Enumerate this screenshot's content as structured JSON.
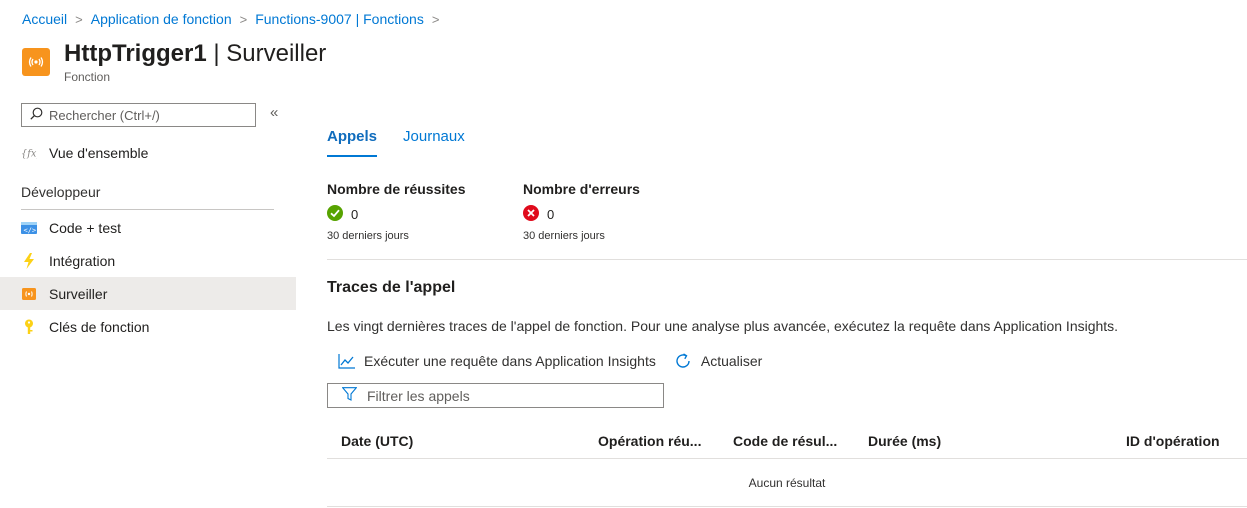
{
  "breadcrumb": {
    "items": [
      "Accueil",
      "Application de fonction",
      "Functions-9007 | Fonctions"
    ],
    "separator": ">"
  },
  "header": {
    "title_bold": "HttpTrigger1",
    "title_rest": " | Surveiller",
    "subtitle": "Fonction",
    "icon": "function-app-icon"
  },
  "sidebar": {
    "search_placeholder": "Rechercher (Ctrl+/)",
    "collapse_label": "«",
    "overview_label": "Vue d'ensemble",
    "section_label": "Développeur",
    "items": [
      {
        "label": "Code + test",
        "icon": "code-icon"
      },
      {
        "label": "Intégration",
        "icon": "lightning-icon"
      },
      {
        "label": "Surveiller",
        "icon": "monitor-icon",
        "selected": true
      },
      {
        "label": "Clés de fonction",
        "icon": "key-icon"
      }
    ]
  },
  "tabs": [
    {
      "label": "Appels",
      "active": true
    },
    {
      "label": "Journaux",
      "active": false
    }
  ],
  "stats": {
    "success": {
      "title": "Nombre de réussites",
      "value": "0",
      "period": "30 derniers jours"
    },
    "errors": {
      "title": "Nombre d'erreurs",
      "value": "0",
      "period": "30 derniers jours"
    }
  },
  "traces": {
    "title": "Traces de l'appel",
    "description": "Les vingt dernières traces de l'appel de fonction. Pour une analyse plus avancée, exécutez la requête dans Application Insights.",
    "run_query_label": "Exécuter une requête dans Application Insights",
    "refresh_label": "Actualiser",
    "filter_placeholder": "Filtrer les appels",
    "columns": [
      "Date (UTC)",
      "Opération réu...",
      "Code de résul...",
      "Durée (ms)",
      "ID d'opération"
    ],
    "empty_text": "Aucun résultat"
  },
  "colors": {
    "accent": "#0078d4",
    "success": "#57a300",
    "error": "#e00b1c",
    "function_icon": "#f7941d"
  }
}
